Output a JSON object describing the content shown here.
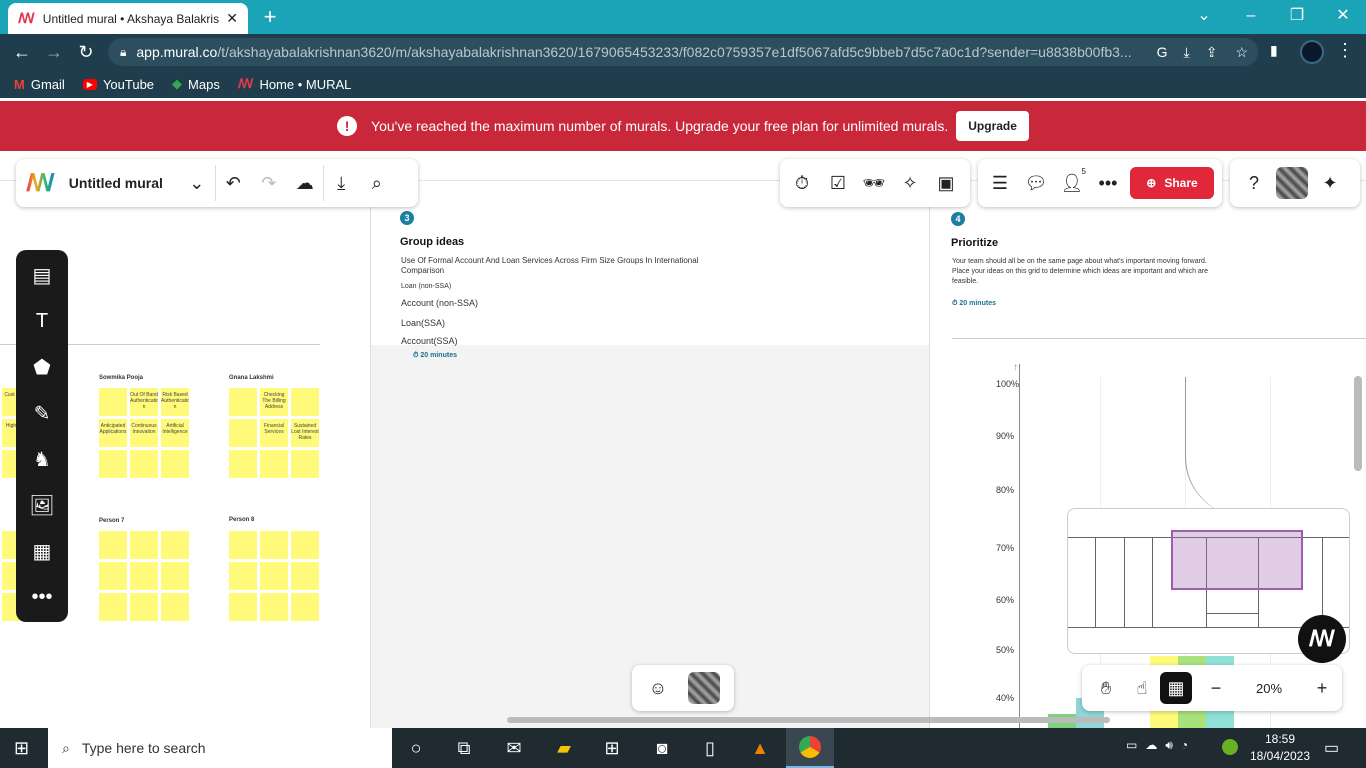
{
  "browser": {
    "tab_title": "Untitled mural • Akshaya Balakris",
    "new_tab": "+",
    "url_host": "app.mural.co",
    "url_path": "/t/akshayabalakrishnan3620/m/akshayabalakrishnan3620/1679065453233/f082c0759357e1df5067afd5c9bbeb7d5c7a0c1d?sender=u8838b00fb3...",
    "bookmarks": [
      "Gmail",
      "YouTube",
      "Maps",
      "Home • MURAL"
    ]
  },
  "banner": {
    "message": "You've reached the maximum number of murals. Upgrade your free plan for unlimited murals.",
    "button": "Upgrade"
  },
  "mural_toolbar": {
    "title": "Untitled mural"
  },
  "collab": {
    "member_count": "5",
    "share_label": "Share"
  },
  "canvas": {
    "step3": {
      "number": "3",
      "title": "Group ideas",
      "subtitle": "Use Of Formal Account And Loan Services Across Firm Size Groups In International Comparison",
      "items": [
        "Loan (non-SSA)",
        "Account (non-SSA)",
        "Loan(SSA)",
        "Account(SSA)"
      ],
      "timer": "20 minutes"
    },
    "step4": {
      "number": "4",
      "title": "Prioritize",
      "body": "Your team should all be on the same page about what's important moving forward. Place your ideas on this grid to determine which ideas are important and which are feasible.",
      "timer": "20 minutes"
    },
    "axis_labels": [
      "100%",
      "90%",
      "80%",
      "70%",
      "60%",
      "50%",
      "40%"
    ],
    "groups": [
      {
        "name": "Sowmika Pooja",
        "stickies": [
          "",
          "Out Of Band Authenticatio n",
          "Risk Based Authenticatio n",
          "Anticipated Applications",
          "Continuous Innovation",
          "Artificial Intelligence",
          "",
          "",
          ""
        ]
      },
      {
        "name": "Gnana Lakshmi",
        "stickies": [
          "",
          "Checking The Billing Address",
          "",
          "",
          "Financial Services",
          "Sustained Lost Interest Rates",
          "",
          "",
          ""
        ]
      },
      {
        "name": "Person 7",
        "stickies": [
          "",
          "",
          "",
          "",
          "",
          "",
          "",
          "",
          ""
        ]
      },
      {
        "name": "Person 8",
        "stickies": [
          "",
          "",
          "",
          "",
          "",
          "",
          "",
          "",
          ""
        ]
      }
    ],
    "left_partial_stickies": [
      "Cust Beha",
      "High Bec"
    ]
  },
  "zoom": {
    "level": "20%"
  },
  "taskbar": {
    "search_placeholder": "Type here to search",
    "time": "18:59",
    "date": "18/04/2023"
  }
}
